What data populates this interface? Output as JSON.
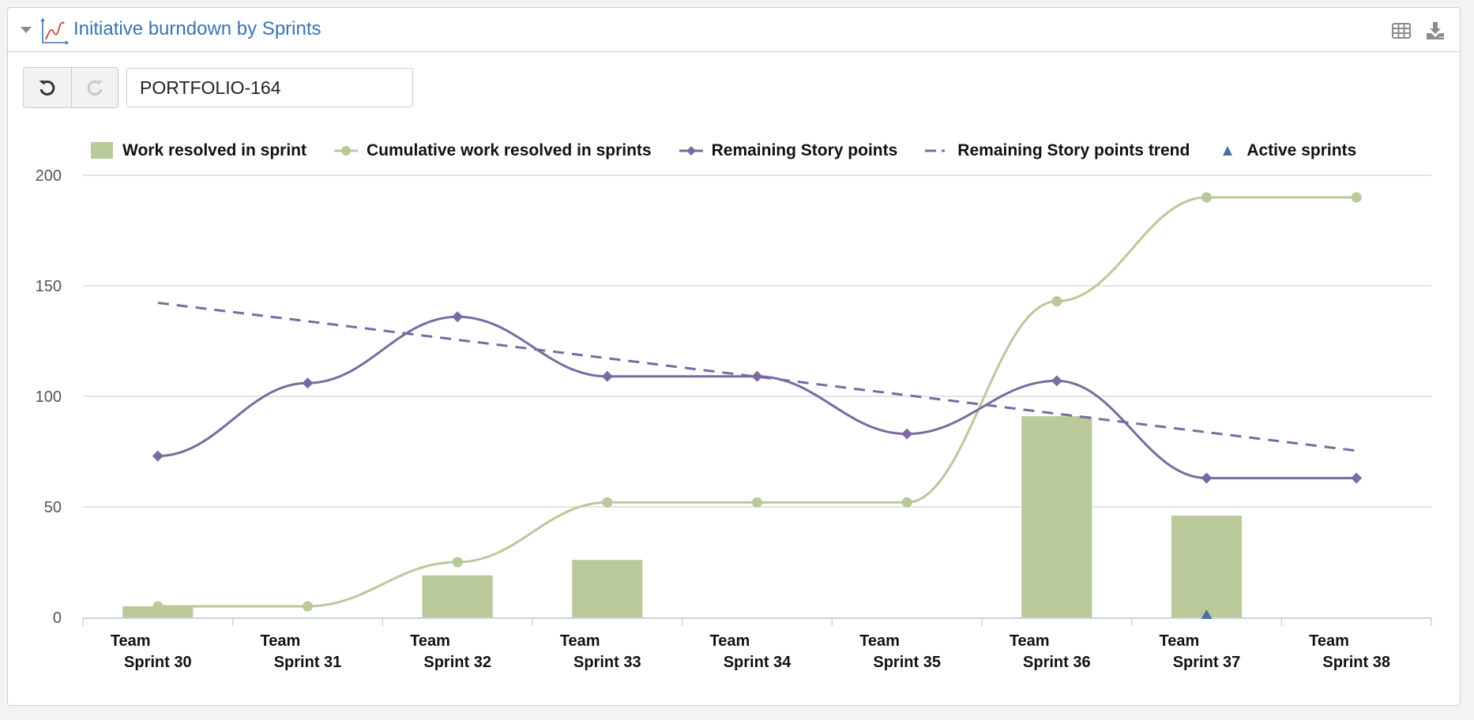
{
  "header": {
    "title": "Initiative burndown by Sprints",
    "icons": [
      "collapse-caret-icon",
      "line-chart-icon",
      "table-view-icon",
      "download-icon"
    ]
  },
  "toolbar": {
    "undo_icon": "undo-icon",
    "redo_icon": "redo-icon",
    "issue_value": "PORTFOLIO-164"
  },
  "colors": {
    "bar": "#b9c99a",
    "cumulative": "#b9c99a",
    "remaining": "#7b6aa0",
    "trend": "#7b6aa0",
    "active": "#4a6ea8",
    "title": "#3b73af"
  },
  "chart_data": {
    "type": "bar",
    "title": "Initiative burndown by Sprints",
    "xlabel": "",
    "ylabel": "",
    "ylim": [
      0,
      200
    ],
    "yticks": [
      0,
      50,
      100,
      150,
      200
    ],
    "grid": true,
    "legend_position": "top",
    "categories": [
      [
        "Team",
        "Sprint 30"
      ],
      [
        "Team",
        "Sprint 31"
      ],
      [
        "Team",
        "Sprint 32"
      ],
      [
        "Team",
        "Sprint 33"
      ],
      [
        "Team",
        "Sprint 34"
      ],
      [
        "Team",
        "Sprint 35"
      ],
      [
        "Team",
        "Sprint 36"
      ],
      [
        "Team",
        "Sprint 37"
      ],
      [
        "Team",
        "Sprint 38"
      ]
    ],
    "series": [
      {
        "name": "Work resolved in sprint",
        "type": "bar",
        "values": [
          5,
          0,
          19,
          26,
          0,
          0,
          91,
          46,
          0
        ]
      },
      {
        "name": "Cumulative work resolved in sprints",
        "type": "spline",
        "marker": "circle",
        "values": [
          5,
          5,
          25,
          52,
          52,
          52,
          143,
          190,
          190
        ]
      },
      {
        "name": "Remaining Story points",
        "type": "spline",
        "marker": "diamond",
        "values": [
          73,
          106,
          136,
          109,
          109,
          83,
          107,
          63,
          63
        ]
      },
      {
        "name": "Remaining Story points trend",
        "type": "line",
        "dash": true,
        "values": [
          142.3,
          133.9,
          125.6,
          117.2,
          108.9,
          100.5,
          92.1,
          83.8,
          75.4
        ]
      },
      {
        "name": "Active sprints",
        "type": "scatter",
        "marker": "triangle",
        "values": [
          null,
          null,
          null,
          null,
          null,
          null,
          null,
          0,
          null
        ]
      }
    ]
  }
}
